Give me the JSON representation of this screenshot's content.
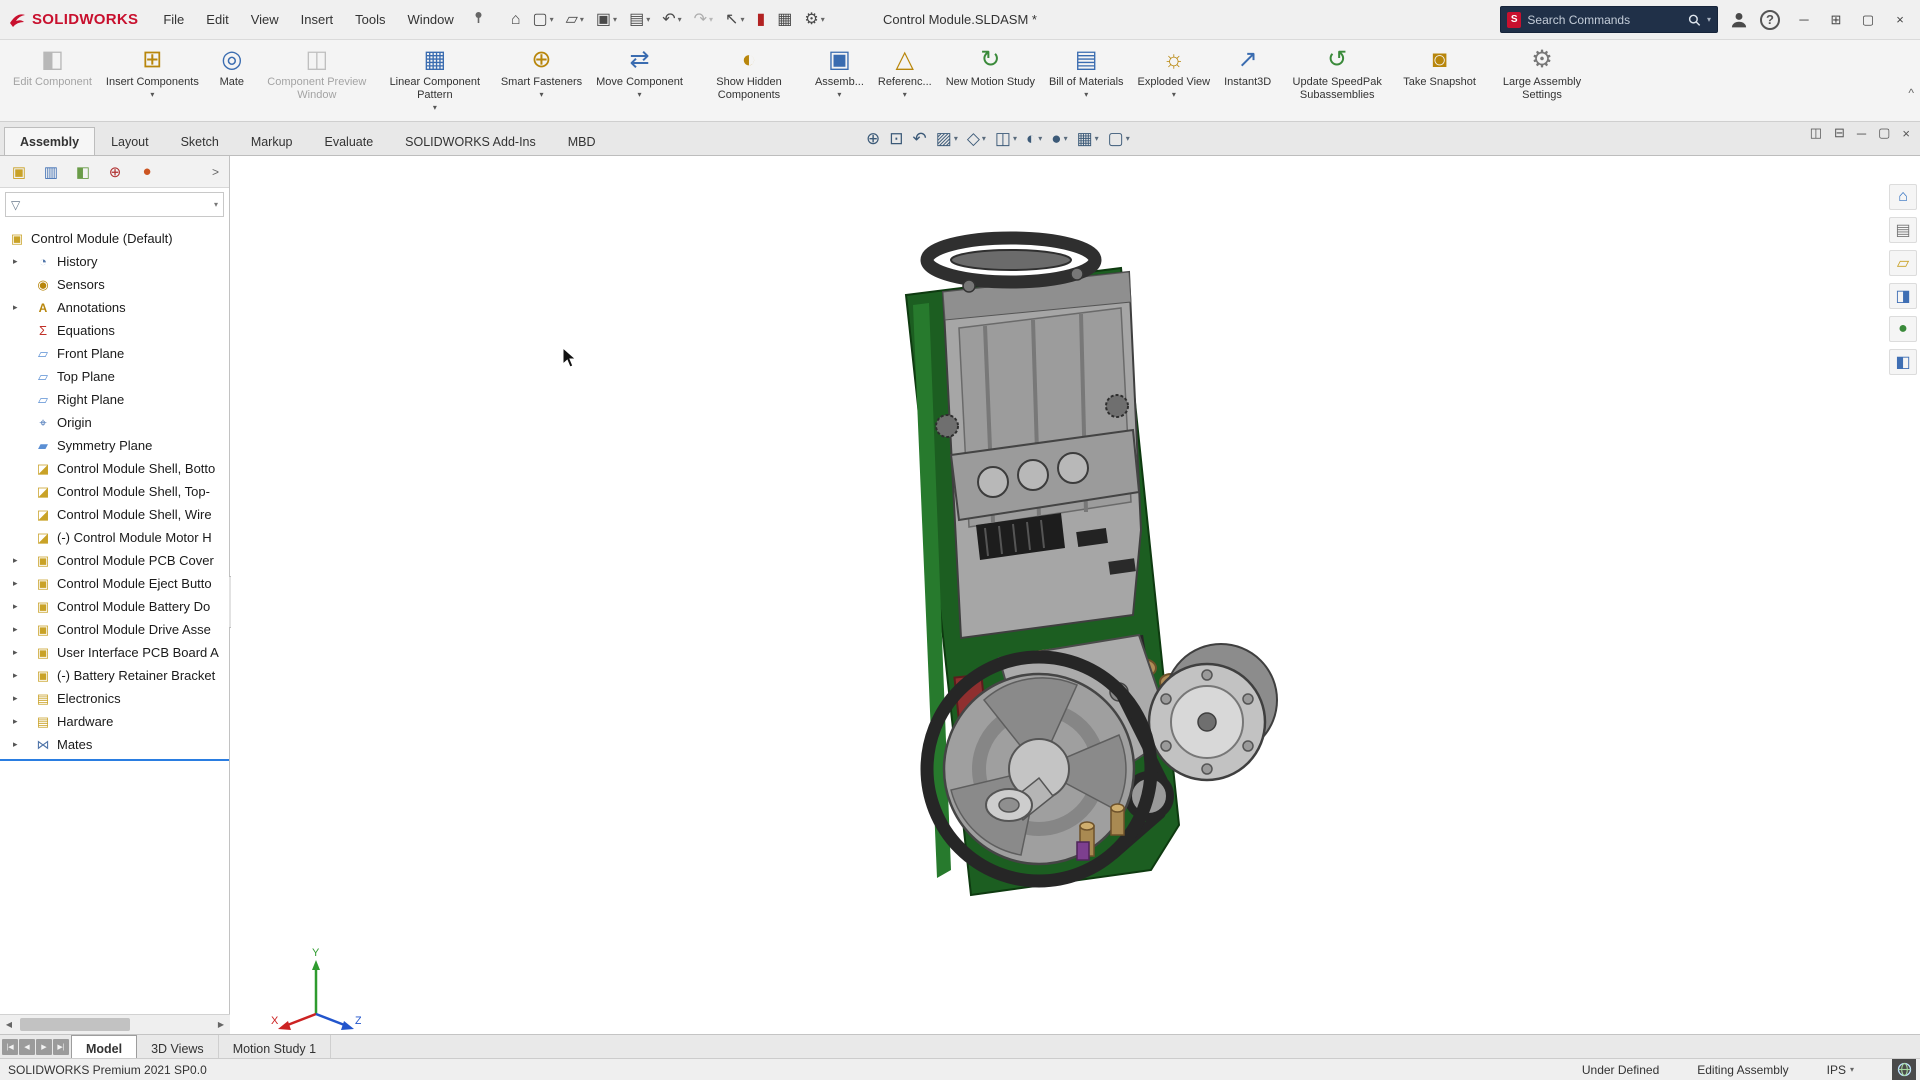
{
  "ui": {
    "caret": "▾",
    "tree_arrow": "▸",
    "left_arrow": "◀",
    "right_arrow": "▶",
    "collapse": "^",
    "chevron": "›",
    "panel_chevron": ">",
    "funnel": "▽"
  },
  "titlebar": {
    "brand": "SOLIDWORKS",
    "menus": [
      "File",
      "Edit",
      "View",
      "Insert",
      "Tools",
      "Window"
    ],
    "quick": [
      {
        "glyph": "⌂"
      },
      {
        "glyph": "▢"
      },
      {
        "glyph": "▱"
      },
      {
        "glyph": "▣"
      },
      {
        "glyph": "▤"
      },
      {
        "glyph": "↶"
      },
      {
        "glyph": "↷"
      },
      {
        "glyph": "↖"
      },
      {
        "glyph": "▮"
      },
      {
        "glyph": "▦"
      },
      {
        "glyph": "⚙"
      }
    ],
    "title": "Control Module.SLDASM *",
    "search_placeholder": "Search Commands",
    "window_controls": {
      "minimize": "─",
      "layout": "⊞",
      "restore": "▢",
      "close": "×"
    }
  },
  "ribbon": {
    "buttons": [
      {
        "glyph": "◧",
        "label": "Edit Component"
      },
      {
        "glyph": "⊞",
        "label": "Insert Components"
      },
      {
        "glyph": "◎",
        "label": "Mate"
      },
      {
        "glyph": "◫",
        "label": "Component Preview Window"
      },
      {
        "glyph": "▦",
        "label": "Linear Component Pattern"
      },
      {
        "glyph": "⊕",
        "label": "Smart Fasteners"
      },
      {
        "glyph": "⇄",
        "label": "Move Component"
      },
      {
        "glyph": "◐",
        "label": "Show Hidden Components"
      },
      {
        "glyph": "▣",
        "label": "Assemb..."
      },
      {
        "glyph": "△",
        "label": "Referenc..."
      },
      {
        "glyph": "↻",
        "label": "New Motion Study"
      },
      {
        "glyph": "▤",
        "label": "Bill of Materials"
      },
      {
        "glyph": "☼",
        "label": "Exploded View"
      },
      {
        "glyph": "↗",
        "label": "Instant3D"
      },
      {
        "glyph": "↺",
        "label": "Update SpeedPak Subassemblies"
      },
      {
        "glyph": "◙",
        "label": "Take Snapshot"
      },
      {
        "glyph": "⚙",
        "label": "Large Assembly Settings"
      }
    ]
  },
  "command_tabs": [
    {
      "label": "Assembly"
    },
    {
      "label": "Layout"
    },
    {
      "label": "Sketch"
    },
    {
      "label": "Markup"
    },
    {
      "label": "Evaluate"
    },
    {
      "label": "SOLIDWORKS Add-Ins"
    },
    {
      "label": "MBD"
    }
  ],
  "viewtools": [
    {
      "glyph": "⊕"
    },
    {
      "glyph": "⊡"
    },
    {
      "glyph": "↶"
    },
    {
      "glyph": "▨"
    },
    {
      "glyph": "◇"
    },
    {
      "glyph": "◫"
    },
    {
      "glyph": "◐"
    },
    {
      "glyph": "●"
    },
    {
      "glyph": "▦"
    },
    {
      "glyph": "▢"
    }
  ],
  "docwin_controls": {
    "pane_a": "◫",
    "pane_b": "⊟",
    "minimize": "─",
    "restore": "▢",
    "close": "×"
  },
  "panel_tabs": [
    {
      "glyph": "▣"
    },
    {
      "glyph": "▥"
    },
    {
      "glyph": "◧"
    },
    {
      "glyph": "⊕"
    },
    {
      "glyph": "●"
    }
  ],
  "tree": {
    "root": {
      "glyph": "▣",
      "label": "Control Module  (Default)"
    },
    "items": [
      {
        "glyph": "◔",
        "label": "History"
      },
      {
        "glyph": "◉",
        "label": "Sensors"
      },
      {
        "glyph": "A",
        "label": "Annotations"
      },
      {
        "glyph": "Σ",
        "label": "Equations"
      },
      {
        "glyph": "▱",
        "label": "Front Plane"
      },
      {
        "glyph": "▱",
        "label": "Top Plane"
      },
      {
        "glyph": "▱",
        "label": "Right Plane"
      },
      {
        "glyph": "⌖",
        "label": "Origin"
      },
      {
        "glyph": "▰",
        "label": "Symmetry Plane"
      },
      {
        "glyph": "◪",
        "label": "Control Module Shell, Botto"
      },
      {
        "glyph": "◪",
        "label": "Control Module Shell, Top-"
      },
      {
        "glyph": "◪",
        "label": "Control Module Shell, Wire"
      },
      {
        "glyph": "◪",
        "label": "(-) Control Module Motor H"
      },
      {
        "glyph": "▣",
        "label": "Control Module PCB Cover"
      },
      {
        "glyph": "▣",
        "label": "Control Module Eject Butto"
      },
      {
        "glyph": "▣",
        "label": "Control Module Battery Do"
      },
      {
        "glyph": "▣",
        "label": "Control Module Drive Asse"
      },
      {
        "glyph": "▣",
        "label": "User Interface PCB Board A"
      },
      {
        "glyph": "▣",
        "label": "(-) Battery Retainer Bracket"
      },
      {
        "glyph": "▤",
        "label": "Electronics"
      },
      {
        "glyph": "▤",
        "label": "Hardware"
      },
      {
        "glyph": "⋈",
        "label": "Mates"
      }
    ]
  },
  "taskpane": [
    {
      "glyph": "⌂"
    },
    {
      "glyph": "▤"
    },
    {
      "glyph": "▱"
    },
    {
      "glyph": "◨"
    },
    {
      "glyph": "●"
    },
    {
      "glyph": "◧"
    }
  ],
  "triad": {
    "x": "X",
    "y": "Y",
    "z": "Z"
  },
  "doctabs": {
    "media": [
      "|◀",
      "◀",
      "▶",
      "▶|"
    ],
    "tabs": [
      {
        "label": "Model"
      },
      {
        "label": "3D Views"
      },
      {
        "label": "Motion Study 1"
      }
    ]
  },
  "statusbar": {
    "left": "SOLIDWORKS Premium 2021 SP0.0",
    "doc_status": "Under Defined",
    "mode": "Editing Assembly",
    "units": "IPS"
  }
}
